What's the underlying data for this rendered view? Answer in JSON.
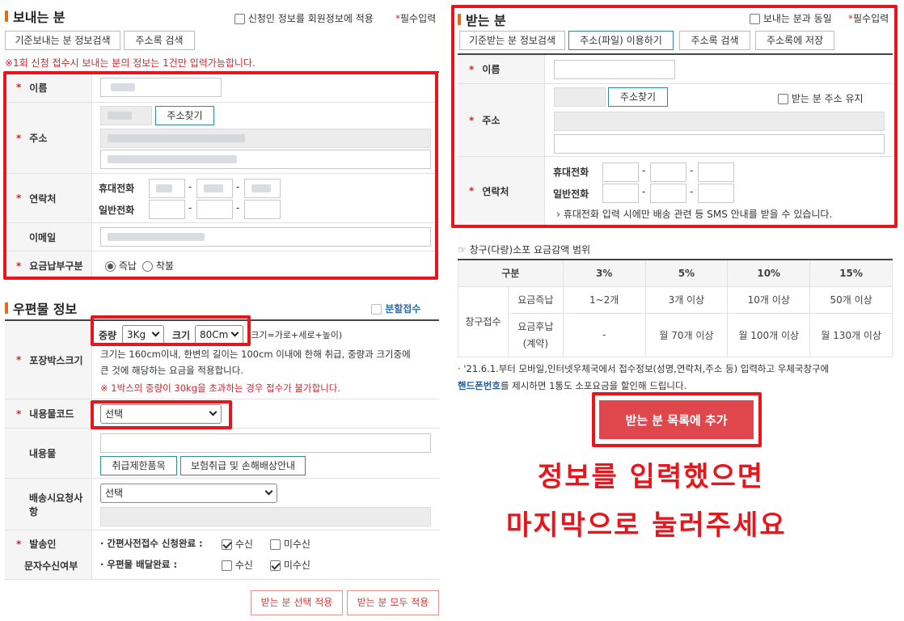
{
  "sender": {
    "title": "보내는 분",
    "apply_member_label": "신청인 정보를 회원정보에 적용",
    "required_label": "필수입력",
    "buttons": {
      "search_default": "기준보내는 분 정보검색",
      "address_book": "주소록 검색"
    },
    "notice": "※1회 신청 접수시 보내는 분의 정보는 1건만 입력가능합니다.",
    "fields": {
      "name": "이름",
      "address": "주소",
      "find_address": "주소찾기",
      "contact": "연락처",
      "mobile": "휴대전화",
      "phone": "일반전화",
      "email": "이메일",
      "payment": "요금납부구분",
      "prepaid": "즉납",
      "collect": "착불"
    }
  },
  "receiver": {
    "title": "받는 분",
    "same_as_sender": "보내는 분과 동일",
    "required_label": "필수입력",
    "buttons": {
      "search_default": "기준받는 분 정보검색",
      "use_file": "주소(파일) 이용하기",
      "address_book": "주소록 검색",
      "save_address_book": "주소록에 저장"
    },
    "fields": {
      "name": "이름",
      "address": "주소",
      "find_address": "주소찾기",
      "keep_address": "받는 분 주소 유지",
      "contact": "연락처",
      "mobile": "휴대전화",
      "phone": "일반전화",
      "sms_notice": "휴대전화 입력 시에만 배송 관련 등 SMS 안내를 받을 수 있습니다."
    }
  },
  "discount": {
    "title": "창구(다량)소포 요금감액 범위",
    "headers": [
      "구분",
      "3%",
      "5%",
      "10%",
      "15%"
    ],
    "group_label": "창구접수",
    "rows": [
      {
        "label": "요금즉납",
        "values": [
          "1~2개",
          "3개 이상",
          "10개 이상",
          "50개 이상"
        ]
      },
      {
        "label": "요금후납",
        "sublabel": "(계약)",
        "values": [
          "-",
          "월 70개 이상",
          "월 100개 이상",
          "월 130개 이상"
        ]
      }
    ],
    "note1": "· '21.6.1.부터 모바일,인터넷우체국에서 접수정보(성명,연락처,주소 등) 입력하고 우체국창구에",
    "note2_bold": "핸드폰번호",
    "note2_rest": "를 제시하면 1통도 소포요금을 할인해 드립니다.",
    "add_button": "받는 분 목록에 추가"
  },
  "instruction": {
    "line1": "정보를 입력했으면",
    "line2": "마지막으로 눌러주세요"
  },
  "postal": {
    "title": "우편물 정보",
    "split_label": "분할접수",
    "box_size": "포장박스크기",
    "weight_label": "중량",
    "weight_value": "3Kg",
    "size_label": "크기",
    "size_value": "80Cm",
    "size_hint": "(크기=가로+세로+높이)",
    "size_desc1": "크기는 160cm이내, 한변의 길이는 100cm 이내에 한해 취급, 중량과 크기중에",
    "size_desc2": "큰 것에 해당하는 요금을 적용합니다.",
    "size_warning": "※ 1박스의 중량이 30kg을 초과하는 경우 접수가 불가합니다.",
    "content_code": "내용물코드",
    "content_code_value": "선택",
    "content": "내용물",
    "restricted_items": "취급제한품목",
    "insurance": "보험취급 및 손해배상안내",
    "delivery_request": "배송시요청사항",
    "delivery_request_value": "선택",
    "sms_label1": "발송인",
    "sms_label2": "문자수신여부",
    "sms_row1": "· 간편사전접수 신청완료 :",
    "sms_row2": "· 우편물 배달완료 :",
    "receive": "수신",
    "not_receive": "미수신",
    "apply_selected": "받는 분 선택 적용",
    "apply_all": "받는 분 모두 적용"
  }
}
